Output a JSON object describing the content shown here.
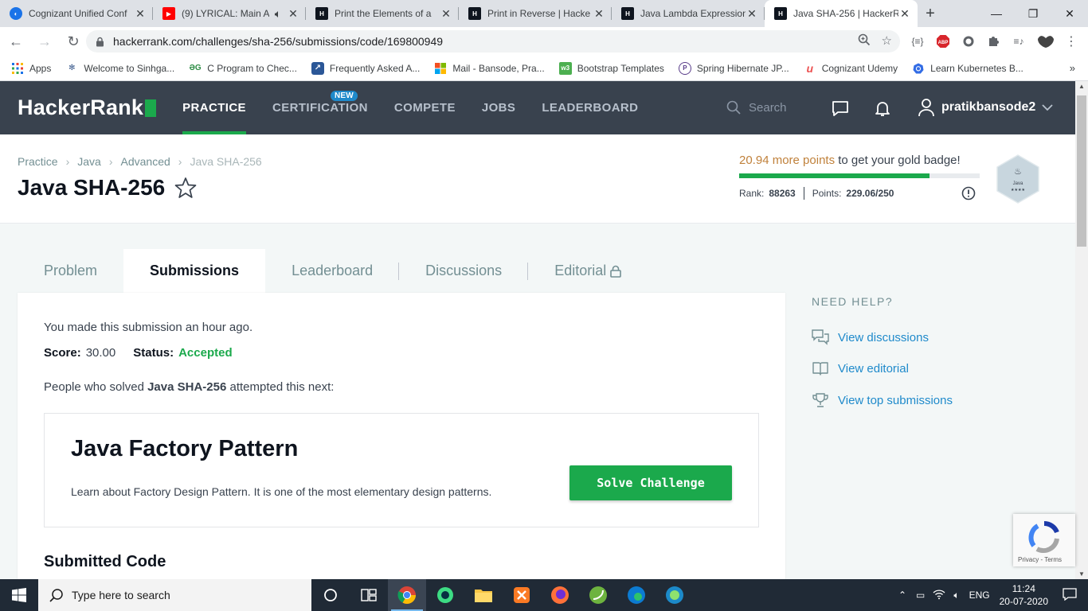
{
  "browser": {
    "tabs": [
      {
        "title": "Cognizant Unified Conf",
        "icon": "cognizant-icon",
        "color": "#1a73e8"
      },
      {
        "title": "(9) LYRICAL: Main A",
        "icon": "youtube-icon",
        "color": "#ff0000"
      },
      {
        "title": "Print the Elements of a",
        "icon": "hackerrank-icon",
        "color": "#0e141e"
      },
      {
        "title": "Print in Reverse | Hacke",
        "icon": "hackerrank-icon",
        "color": "#0e141e"
      },
      {
        "title": "Java Lambda Expression",
        "icon": "hackerrank-icon",
        "color": "#0e141e"
      },
      {
        "title": "Java SHA-256 | HackerR",
        "icon": "hackerrank-icon",
        "color": "#0e141e"
      }
    ],
    "url": "hackerrank.com/challenges/sha-256/submissions/code/169800949",
    "bookmarks": [
      {
        "label": "Apps",
        "icon": "apps-grid-icon"
      },
      {
        "label": "Welcome to Sinhga...",
        "icon": "sinhgad-icon"
      },
      {
        "label": "C Program to Chec...",
        "icon": "geeksforgeeks-icon"
      },
      {
        "label": "Frequently Asked A...",
        "icon": "bookmark-site-icon"
      },
      {
        "label": "Mail - Bansode, Pra...",
        "icon": "microsoft-icon"
      },
      {
        "label": "Bootstrap Templates",
        "icon": "w3-icon"
      },
      {
        "label": "Spring Hibernate JP...",
        "icon": "spring-icon"
      },
      {
        "label": "Cognizant Udemy",
        "icon": "udemy-icon"
      },
      {
        "label": "Learn Kubernetes B...",
        "icon": "kubernetes-icon"
      }
    ],
    "bookmarks_more": "»",
    "extensions": {
      "abp": "ABP",
      "json": "{≡}"
    }
  },
  "header": {
    "logo": "HackerRank",
    "nav": [
      {
        "label": "PRACTICE",
        "active": true
      },
      {
        "label": "CERTIFICATION",
        "badge": "NEW"
      },
      {
        "label": "COMPETE"
      },
      {
        "label": "JOBS"
      },
      {
        "label": "LEADERBOARD"
      }
    ],
    "search_placeholder": "Search",
    "username": "pratikbansode2",
    "brand_green": "#1ba94c"
  },
  "breadcrumb": [
    "Practice",
    "Java",
    "Advanced",
    "Java SHA-256"
  ],
  "challenge": {
    "title": "Java SHA-256"
  },
  "progress": {
    "points_needed": "20.94 more points",
    "message_rest": " to get your gold badge!",
    "fraction": 0.79,
    "rank_label": "Rank:",
    "rank": "88263",
    "points_label": "Points:",
    "points": "229.06/250",
    "badge_label": "Java",
    "badge_stars": "★★★★"
  },
  "content_tabs": [
    {
      "label": "Problem"
    },
    {
      "label": "Submissions",
      "active": true
    },
    {
      "label": "Leaderboard"
    },
    {
      "label": "Discussions"
    },
    {
      "label": "Editorial",
      "locked": true
    }
  ],
  "submission": {
    "made": "You made this submission an hour ago.",
    "score_label": "Score:",
    "score": "30.00",
    "status_label": "Status:",
    "status": "Accepted",
    "people_prefix": "People who solved ",
    "people_challenge": "Java SHA-256",
    "people_suffix": " attempted this next:"
  },
  "next_challenge": {
    "title": "Java Factory Pattern",
    "description": "Learn about Factory Design Pattern. It is one of the most elementary design patterns.",
    "button": "Solve Challenge"
  },
  "submitted_code_heading": "Submitted Code",
  "help": {
    "title": "NEED HELP?",
    "links": [
      {
        "label": "View discussions",
        "icon": "discussion-icon"
      },
      {
        "label": "View editorial",
        "icon": "book-icon"
      },
      {
        "label": "View top submissions",
        "icon": "trophy-icon"
      }
    ]
  },
  "recaptcha": {
    "privacy": "Privacy",
    "sep": " - ",
    "terms": "Terms"
  },
  "taskbar": {
    "search_placeholder": "Type here to search",
    "language": "ENG",
    "time": "11:24",
    "date": "20-07-2020"
  }
}
